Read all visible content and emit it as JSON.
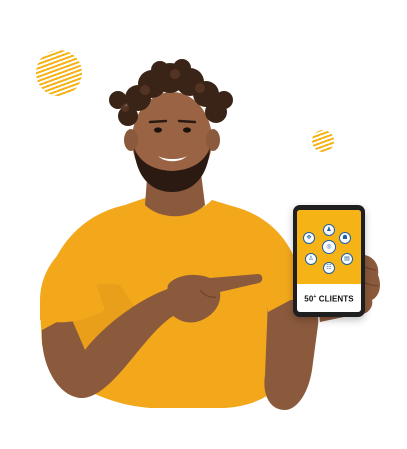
{
  "colors": {
    "accent": "#f5b316",
    "shirt": "#f3a81c",
    "node_border": "#1d5fa8"
  },
  "tablet": {
    "label": "50",
    "label_sup": "+",
    "label_suffix": " CLIENTS",
    "nodes": [
      {
        "name": "arrows-icon",
        "glyph": "✥"
      },
      {
        "name": "people-icon",
        "glyph": "♟"
      },
      {
        "name": "team-icon",
        "glyph": "☗"
      },
      {
        "name": "group-icon",
        "glyph": "♙"
      },
      {
        "name": "meeting-icon",
        "glyph": "☷"
      },
      {
        "name": "presentation-icon",
        "glyph": "▤"
      },
      {
        "name": "network-icon",
        "glyph": "❖"
      }
    ]
  }
}
